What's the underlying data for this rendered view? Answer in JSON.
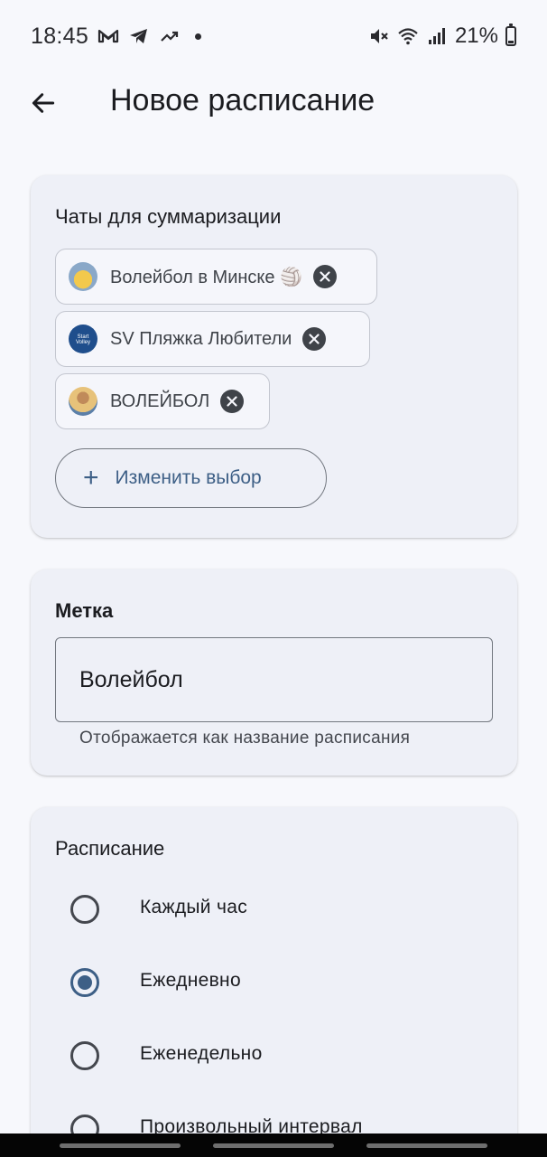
{
  "status_bar": {
    "time": "18:45",
    "left_icons": [
      "gmail-icon",
      "telegram-icon",
      "trending-icon",
      "notification-dot"
    ],
    "right_icons": [
      "mute-icon",
      "wifi-icon",
      "signal-icon",
      "battery-icon"
    ],
    "battery_percent": "21%"
  },
  "app_bar": {
    "back_icon": "arrow-back-icon",
    "title": "Новое расписание"
  },
  "chats_card": {
    "title": "Чаты для суммаризации",
    "chips": [
      {
        "label": "Волейбол в Минске 🏐",
        "avatar": "volleyball-group-avatar"
      },
      {
        "label": "SV Пляжка Любители",
        "avatar": "start-volley-avatar"
      },
      {
        "label": "ВОЛЕЙБОЛ",
        "avatar": "person-avatar"
      }
    ],
    "change_button": "Изменить выбор"
  },
  "label_card": {
    "title": "Метка",
    "field_value": "Волейбол",
    "helper_text": "Отображается как название расписания"
  },
  "schedule_card": {
    "title": "Расписание",
    "options": [
      {
        "label": "Каждый час",
        "selected": false
      },
      {
        "label": "Ежедневно",
        "selected": true
      },
      {
        "label": "Еженедельно",
        "selected": false
      },
      {
        "label": "Произвольный интервал",
        "selected": false
      }
    ]
  },
  "colors": {
    "accent": "#3d5f86",
    "background": "#f7f8fc",
    "card": "#eef0f7",
    "chip_close": "#3f4349"
  }
}
